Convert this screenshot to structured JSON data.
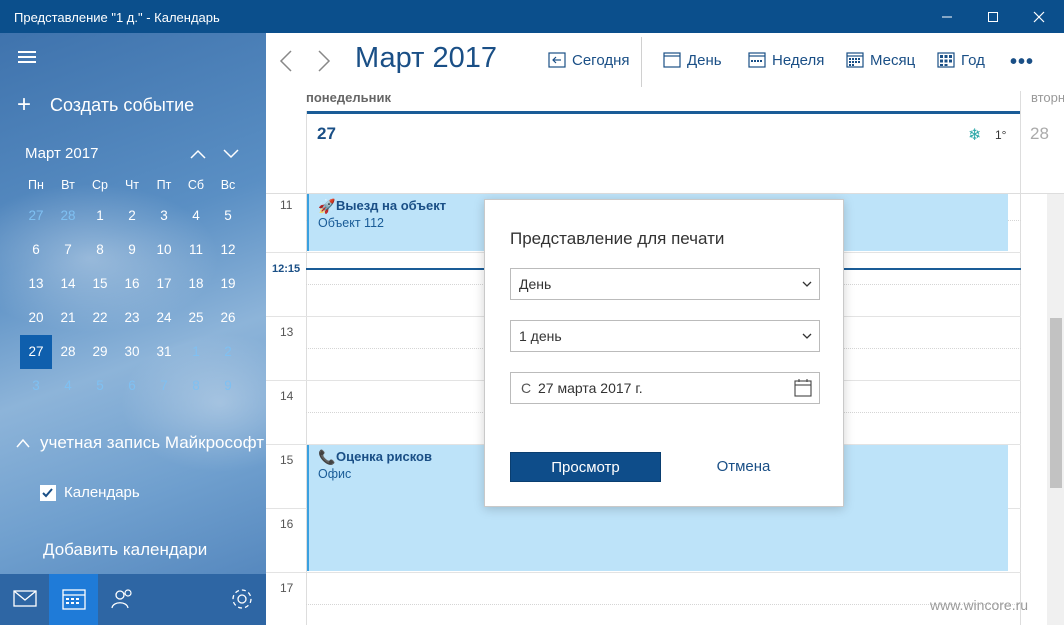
{
  "window": {
    "title": "Представление \"1 д.\" - Календарь"
  },
  "sidebar": {
    "new_event": "Создать событие",
    "mini_month": "Март 2017",
    "weekdays": [
      "Пн",
      "Вт",
      "Ср",
      "Чт",
      "Пт",
      "Сб",
      "Вс"
    ],
    "weeks": [
      [
        "27",
        "28",
        "1",
        "2",
        "3",
        "4",
        "5"
      ],
      [
        "6",
        "7",
        "8",
        "9",
        "10",
        "11",
        "12"
      ],
      [
        "13",
        "14",
        "15",
        "16",
        "17",
        "18",
        "19"
      ],
      [
        "20",
        "21",
        "22",
        "23",
        "24",
        "25",
        "26"
      ],
      [
        "27",
        "28",
        "29",
        "30",
        "31",
        "1",
        "2"
      ],
      [
        "3",
        "4",
        "5",
        "6",
        "7",
        "8",
        "9"
      ]
    ],
    "account": "учетная запись Майкрософт",
    "calendar_item": "Календарь",
    "add_calendars": "Добавить календари"
  },
  "toolbar": {
    "month_title": "Март 2017",
    "today": "Сегодня",
    "day": "День",
    "week": "Неделя",
    "month": "Месяц",
    "year": "Год",
    "more": "•••"
  },
  "day_view": {
    "weekday": "понедельник",
    "weekday_next": "вторник",
    "day_number": "27",
    "day_number_next": "28",
    "weather_icon": "❄",
    "temperature": "1°",
    "current_time": "12:15",
    "hours": [
      "11",
      "13",
      "14",
      "15",
      "16",
      "17"
    ],
    "events": [
      {
        "title": "Выезд на объект",
        "location": "Объект 112",
        "icon": "🚀"
      },
      {
        "title": "Оценка рисков",
        "location": "Офис",
        "icon": "📞"
      }
    ]
  },
  "dialog": {
    "title": "Представление для печати",
    "view_select": "День",
    "range_select": "1 день",
    "date_prefix": "С",
    "date_value": "27 марта 2017 г.",
    "preview_button": "Просмотр",
    "cancel_button": "Отмена"
  },
  "watermark": "www.wincore.ru"
}
